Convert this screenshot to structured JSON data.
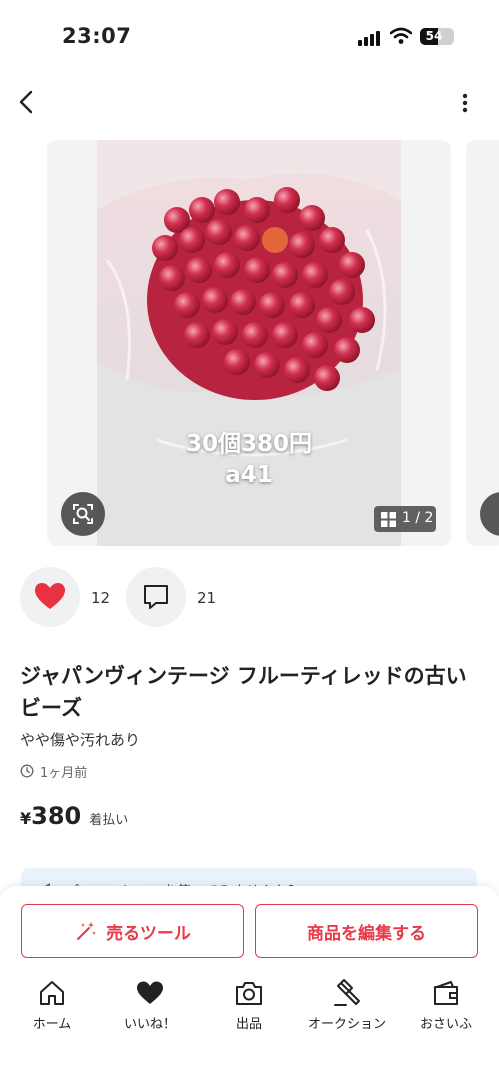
{
  "status_bar": {
    "time": "23:07",
    "battery": "54"
  },
  "product": {
    "image_overlay": {
      "price_text": "30個380円",
      "code_text": "a41"
    },
    "image_counter": "1 / 2",
    "likes": "12",
    "comments": "21",
    "title": "ジャパンヴィンテージ フルーティレッドの古いビーズ",
    "condition": "やや傷や汚れあり",
    "posted": "1ヶ月前",
    "price_symbol": "¥",
    "price": "380",
    "shipping": "着払い"
  },
  "promo_banner": {
    "text": "プロモーションを使ってみませんか？"
  },
  "actions": {
    "sell_tool": "売るツール",
    "edit_item": "商品を編集する"
  },
  "tab_bar": {
    "items": [
      {
        "label": "ホーム",
        "icon": "home-icon"
      },
      {
        "label": "いいね！",
        "icon": "heart-icon"
      },
      {
        "label": "出品",
        "icon": "camera-icon"
      },
      {
        "label": "オークション",
        "icon": "gavel-icon"
      },
      {
        "label": "おさいふ",
        "icon": "wallet-icon"
      }
    ]
  },
  "colors": {
    "accent": "#e83a46",
    "like_heart": "#e8323f",
    "banner_bg": "#eaf2fb",
    "icon_bg": "#f1f1f3"
  }
}
